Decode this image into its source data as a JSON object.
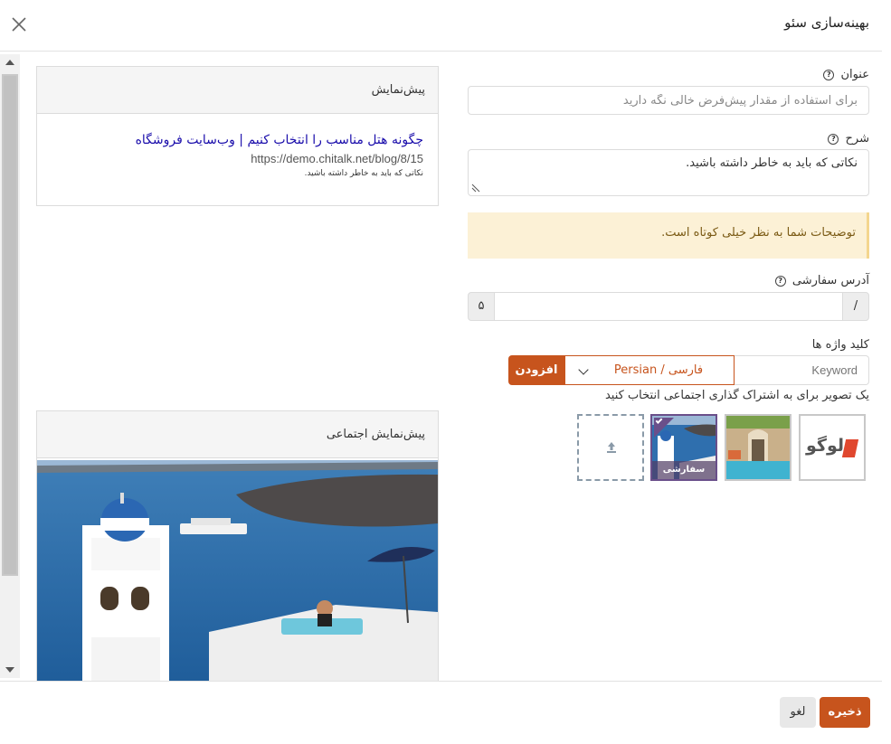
{
  "modal": {
    "title": "بهینه‌سازی سئو"
  },
  "preview": {
    "heading": "پیش‌نمایش",
    "title": "چگونه هتل مناسب را انتخاب کنیم | وب‌سایت فروشگاه",
    "url": "https://demo.chitalk.net/blog/8/15",
    "description": "نکاتی که باید به خاطر داشته باشید."
  },
  "social_preview": {
    "heading": "پیش‌نمایش اجتماعی"
  },
  "fields": {
    "title": {
      "label": "عنوان",
      "placeholder": "برای استفاده از مقدار پیش‌فرض خالی نگه دارید",
      "value": ""
    },
    "description": {
      "label": "شرح",
      "value": "نکاتی که باید به خاطر داشته باشید."
    },
    "alert": "توضیحات شما به نظر خیلی کوتاه است.",
    "custom_url": {
      "label": "آدرس سفارشی",
      "prefix": "/",
      "suffix": "۵",
      "value": ""
    },
    "keywords": {
      "label": "کلید واژه ها",
      "placeholder": "Keyword",
      "language": "Persian / فارسی",
      "add_label": "افزودن"
    },
    "image_hint": "یک تصویر برای به اشتراک گذاری اجتماعی انتخاب کنید",
    "images": {
      "logo_text": "لوگو",
      "selected_label": "سفارشی"
    }
  },
  "footer": {
    "save_label": "ذخیره",
    "cancel_label": "لغو"
  },
  "colors": {
    "accent": "#c7541d",
    "link": "#1a0dab",
    "alert_bg": "#fcf1d6",
    "selected": "#6a4f8a"
  }
}
